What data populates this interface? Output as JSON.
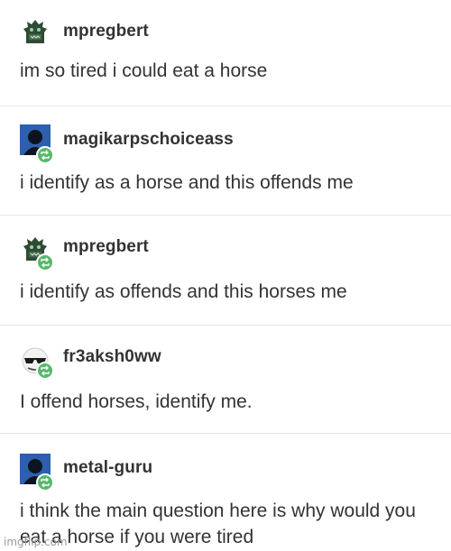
{
  "posts": [
    {
      "username": "mpregbert",
      "text": "im so tired i could eat a horse",
      "avatar": "gargoyle-avatar",
      "reblog": false
    },
    {
      "username": "magikarpschoiceass",
      "text": "i identify as a horse and this offends me",
      "avatar": "silhouette-avatar",
      "reblog": true
    },
    {
      "username": "mpregbert",
      "text": "i identify as offends and this horses me",
      "avatar": "gargoyle-avatar",
      "reblog": true
    },
    {
      "username": "fr3aksh0ww",
      "text": "I offend horses, identify me.",
      "avatar": "sunglasses-avatar",
      "reblog": true
    },
    {
      "username": "metal-guru",
      "text": "i think the main question here is why would you eat a horse if you were tired",
      "avatar": "silhouette-avatar",
      "reblog": true
    }
  ],
  "watermark": "imgflip.com",
  "colors": {
    "reblog_badge": "#56b86c",
    "divider": "#e6e6e6",
    "text": "#333333"
  }
}
